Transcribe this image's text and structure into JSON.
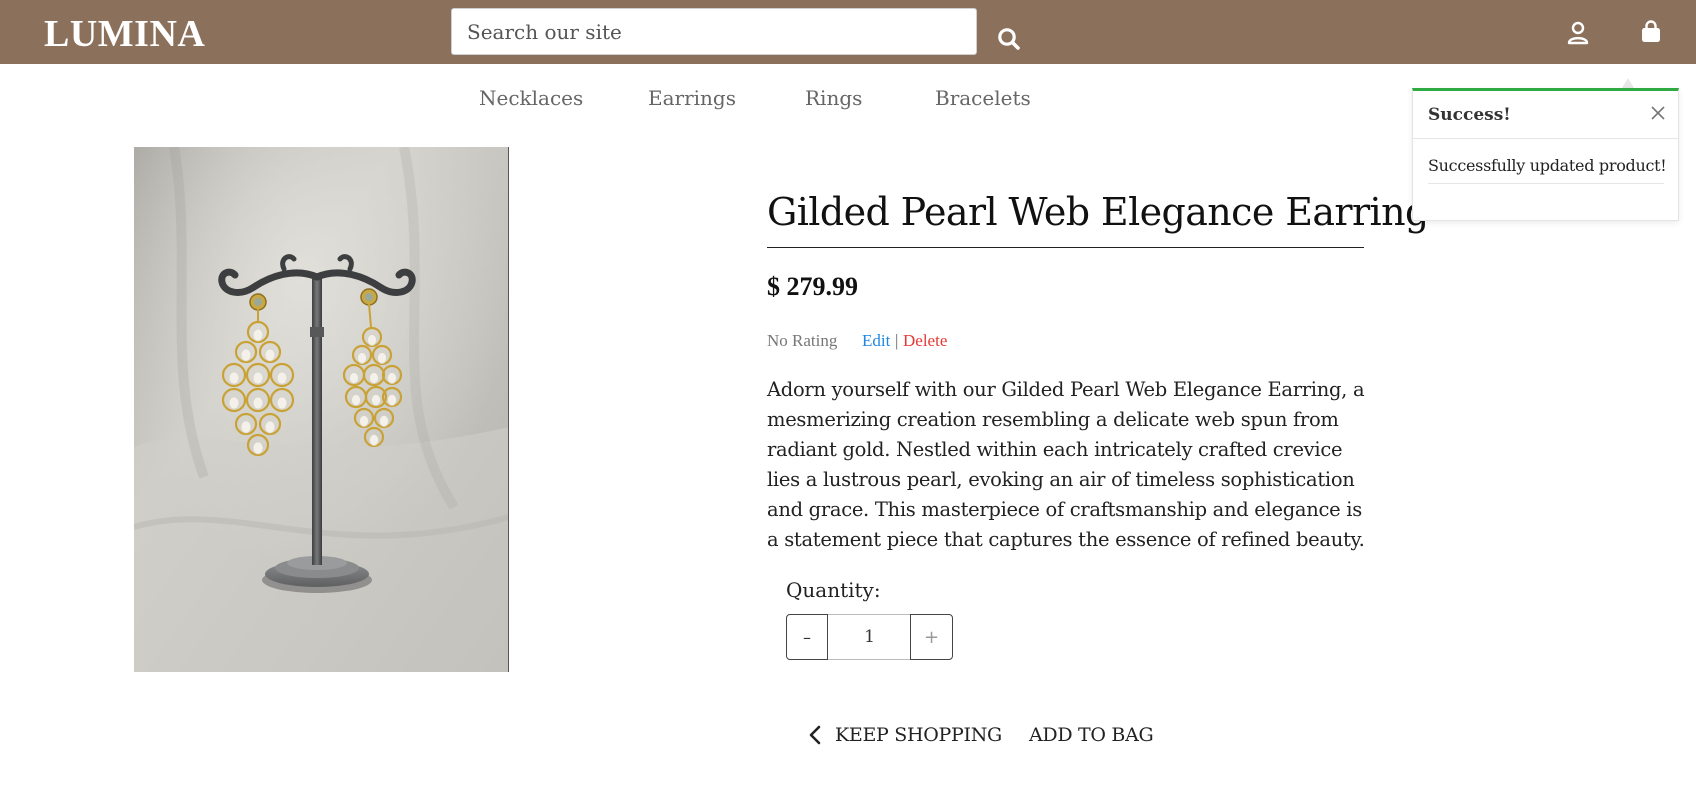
{
  "header": {
    "logo": "LUMINA",
    "search": {
      "placeholder": "Search our site",
      "value": ""
    },
    "icons": [
      "search-icon",
      "user-icon",
      "bag-icon"
    ],
    "bar_color": "#8b705b"
  },
  "nav": {
    "items": [
      {
        "label": "Necklaces"
      },
      {
        "label": "Earrings"
      },
      {
        "label": "Rings"
      },
      {
        "label": "Bracelets"
      }
    ]
  },
  "product": {
    "title": "Gilded Pearl Web Elegance Earring",
    "price": "$ 279.99",
    "rating": "No Rating",
    "edit_label": "Edit",
    "separator": "|",
    "delete_label": "Delete",
    "description": "Adorn yourself with our Gilded Pearl Web Elegance Earring, a mesmerizing creation resembling a delicate web spun from radiant gold. Nestled within each intricately crafted crevice lies a lustrous pearl, evoking an air of timeless sophistication and grace. This masterpiece of craftsmanship and elegance is a statement piece that captures the essence of refined beauty.",
    "quantity_label": "Quantity:",
    "quantity_value": "1",
    "minus_label": "–",
    "plus_label": "+",
    "keep_shopping_label": "KEEP SHOPPING",
    "add_to_bag_label": "ADD TO BAG"
  },
  "toast": {
    "title": "Success!",
    "message": "Successfully updated product!",
    "accent_color": "#2eaa43"
  },
  "colors": {
    "edit_link": "#1e88e5",
    "delete_link": "#e53935"
  }
}
